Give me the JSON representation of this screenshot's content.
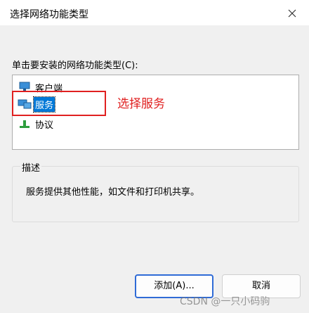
{
  "window": {
    "title": "选择网络功能类型"
  },
  "list": {
    "label": "单击要安装的网络功能类型(C):",
    "items": [
      {
        "label": "客户端",
        "icon": "client-icon"
      },
      {
        "label": "服务",
        "icon": "service-icon",
        "selected": true
      },
      {
        "label": "协议",
        "icon": "protocol-icon"
      }
    ]
  },
  "annotation": {
    "text": "选择服务",
    "color": "#e02020"
  },
  "description": {
    "title": "描述",
    "text": "服务提供其他性能，如文件和打印机共享。"
  },
  "buttons": {
    "add": "添加(A)...",
    "cancel": "取消"
  },
  "watermark": "CSDN @一只小码驹",
  "colors": {
    "selection": "#0078d7",
    "annotation": "#e02020",
    "default_button_border": "#2f6bd6"
  }
}
